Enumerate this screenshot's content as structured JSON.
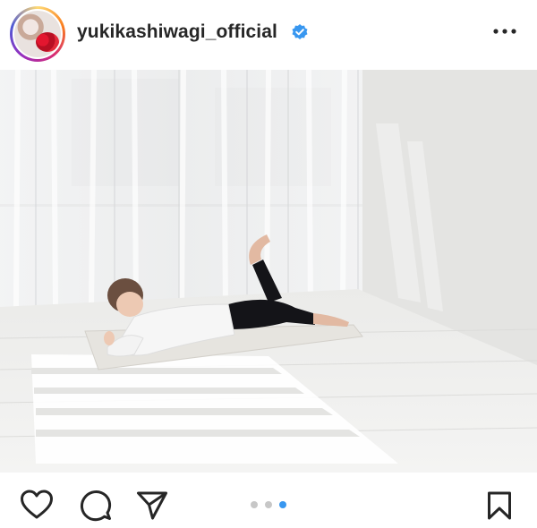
{
  "post": {
    "username": "yukikashiwagi_official",
    "verified": true,
    "carousel": {
      "total": 3,
      "current": 3
    }
  },
  "colors": {
    "accent": "#3897f0",
    "text": "#262626",
    "verified_badge": "#3897f0"
  },
  "icons": {
    "more": "more-options-icon",
    "like": "heart-icon",
    "comment": "comment-icon",
    "share": "paper-plane-icon",
    "save": "bookmark-icon",
    "verified": "verified-badge-icon"
  }
}
